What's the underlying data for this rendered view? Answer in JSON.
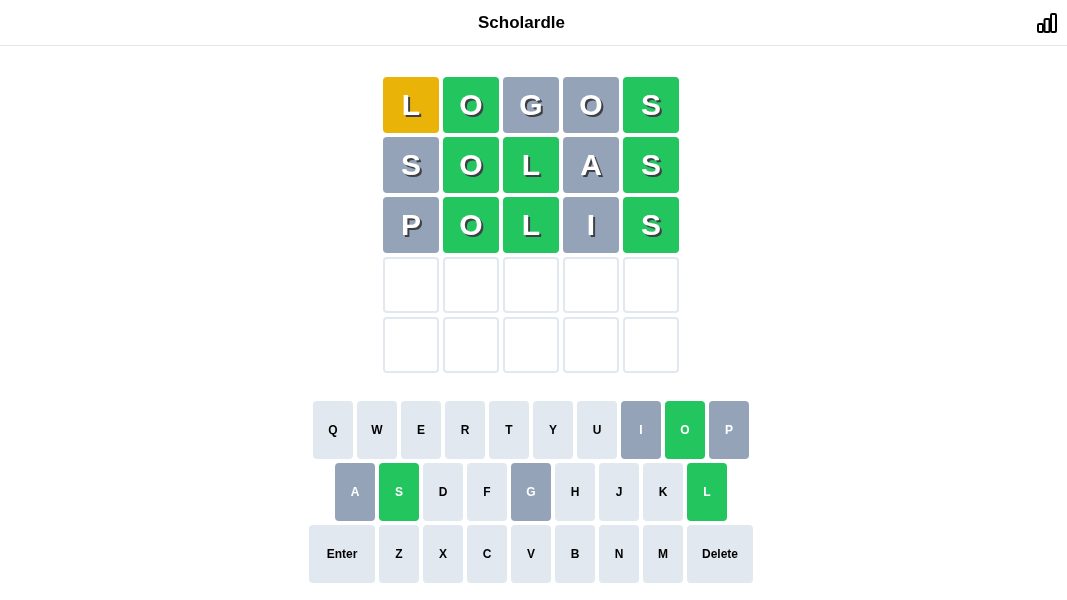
{
  "header": {
    "title": "Scholardle"
  },
  "board": {
    "rows": [
      {
        "tiles": [
          {
            "kind": "letter",
            "letter": "L",
            "color": "#eab308"
          },
          {
            "kind": "letter",
            "letter": "O",
            "color": "#22c55e"
          },
          {
            "kind": "letter",
            "letter": "G",
            "color": "#94a3b8"
          },
          {
            "kind": "letter",
            "letter": "O",
            "color": "#94a3b8"
          },
          {
            "kind": "letter",
            "letter": "S",
            "color": "#22c55e"
          }
        ]
      },
      {
        "tiles": [
          {
            "kind": "letter",
            "letter": "S",
            "color": "#94a3b8"
          },
          {
            "kind": "letter",
            "letter": "O",
            "color": "#22c55e"
          },
          {
            "kind": "letter",
            "letter": "L",
            "color": "#22c55e"
          },
          {
            "kind": "letter",
            "letter": "A",
            "color": "#94a3b8"
          },
          {
            "kind": "letter",
            "letter": "S",
            "color": "#22c55e"
          }
        ]
      },
      {
        "tiles": [
          {
            "kind": "letter",
            "letter": "P",
            "color": "#94a3b8"
          },
          {
            "kind": "letter",
            "letter": "O",
            "color": "#22c55e"
          },
          {
            "kind": "letter",
            "letter": "L",
            "color": "#22c55e"
          },
          {
            "kind": "letter",
            "letter": "I",
            "color": "#94a3b8"
          },
          {
            "kind": "letter",
            "letter": "S",
            "color": "#22c55e"
          }
        ]
      },
      {
        "tiles": [
          {
            "kind": "empty"
          },
          {
            "kind": "empty"
          },
          {
            "kind": "empty"
          },
          {
            "kind": "empty"
          },
          {
            "kind": "empty"
          }
        ]
      },
      {
        "tiles": [
          {
            "kind": "empty"
          },
          {
            "kind": "empty"
          },
          {
            "kind": "empty"
          },
          {
            "kind": "empty"
          },
          {
            "kind": "empty"
          }
        ]
      }
    ]
  },
  "keyboard": {
    "rows": [
      {
        "keys": [
          {
            "label": "Q",
            "kind": "letter",
            "color": "#e2e8f0"
          },
          {
            "label": "W",
            "kind": "letter",
            "color": "#e2e8f0"
          },
          {
            "label": "E",
            "kind": "letter",
            "color": "#e2e8f0"
          },
          {
            "label": "R",
            "kind": "letter",
            "color": "#e2e8f0"
          },
          {
            "label": "T",
            "kind": "letter",
            "color": "#e2e8f0"
          },
          {
            "label": "Y",
            "kind": "letter",
            "color": "#e2e8f0"
          },
          {
            "label": "U",
            "kind": "letter",
            "color": "#e2e8f0"
          },
          {
            "label": "I",
            "kind": "letter",
            "color": "#94a3b8"
          },
          {
            "label": "O",
            "kind": "letter",
            "color": "#22c55e"
          },
          {
            "label": "P",
            "kind": "letter",
            "color": "#94a3b8"
          }
        ]
      },
      {
        "keys": [
          {
            "label": "A",
            "kind": "letter",
            "color": "#94a3b8"
          },
          {
            "label": "S",
            "kind": "letter",
            "color": "#22c55e"
          },
          {
            "label": "D",
            "kind": "letter",
            "color": "#e2e8f0"
          },
          {
            "label": "F",
            "kind": "letter",
            "color": "#e2e8f0"
          },
          {
            "label": "G",
            "kind": "letter",
            "color": "#94a3b8"
          },
          {
            "label": "H",
            "kind": "letter",
            "color": "#e2e8f0"
          },
          {
            "label": "J",
            "kind": "letter",
            "color": "#e2e8f0"
          },
          {
            "label": "K",
            "kind": "letter",
            "color": "#e2e8f0"
          },
          {
            "label": "L",
            "kind": "letter",
            "color": "#22c55e"
          }
        ]
      },
      {
        "keys": [
          {
            "label": "Enter",
            "kind": "action",
            "color": "#e2e8f0"
          },
          {
            "label": "Z",
            "kind": "letter",
            "color": "#e2e8f0"
          },
          {
            "label": "X",
            "kind": "letter",
            "color": "#e2e8f0"
          },
          {
            "label": "C",
            "kind": "letter",
            "color": "#e2e8f0"
          },
          {
            "label": "V",
            "kind": "letter",
            "color": "#e2e8f0"
          },
          {
            "label": "B",
            "kind": "letter",
            "color": "#e2e8f0"
          },
          {
            "label": "N",
            "kind": "letter",
            "color": "#e2e8f0"
          },
          {
            "label": "M",
            "kind": "letter",
            "color": "#e2e8f0"
          },
          {
            "label": "Delete",
            "kind": "action",
            "color": "#e2e8f0"
          }
        ]
      }
    ]
  }
}
